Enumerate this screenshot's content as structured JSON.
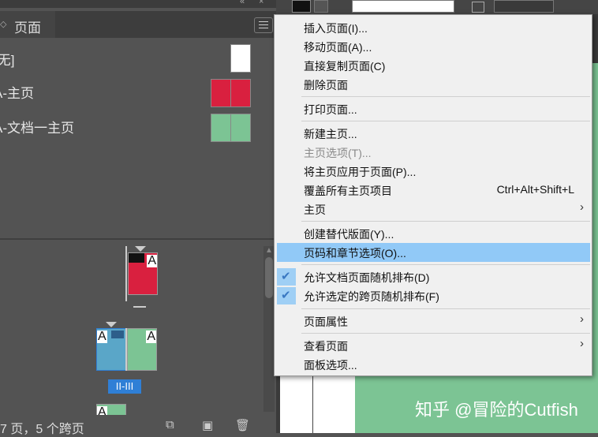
{
  "panel": {
    "tab_title": "页面",
    "masters": [
      {
        "label": "[无]"
      },
      {
        "label": "A-主页"
      },
      {
        "label": "A-文档一主页"
      }
    ],
    "page_letter": "A",
    "spread_label": "II-III",
    "footer_text": "7 页，5 个跨页"
  },
  "menu": {
    "items": [
      {
        "label": "插入页面(I)..."
      },
      {
        "label": "移动页面(A)..."
      },
      {
        "label": "直接复制页面(C)"
      },
      {
        "label": "删除页面"
      },
      {
        "label": "打印页面..."
      },
      {
        "label": "新建主页..."
      },
      {
        "label": "主页选项(T)...",
        "disabled": true
      },
      {
        "label": "将主页应用于页面(P)..."
      },
      {
        "label": "覆盖所有主页项目",
        "shortcut": "Ctrl+Alt+Shift+L"
      },
      {
        "label": "主页",
        "submenu": true
      },
      {
        "label": "创建替代版面(Y)..."
      },
      {
        "label": "页码和章节选项(O)...",
        "highlighted": true
      },
      {
        "label": "允许文档页面随机排布(D)",
        "checked": true
      },
      {
        "label": "允许选定的跨页随机排布(F)",
        "checked": true
      },
      {
        "label": "页面属性",
        "submenu": true
      },
      {
        "label": "查看页面",
        "submenu": true
      },
      {
        "label": "面板选项..."
      }
    ]
  },
  "document": {
    "watermark": "知乎 @冒险的Cutfish"
  },
  "colors": {
    "red_master": "#d9203f",
    "green_master": "#7cc494",
    "blue_selected": "#5aa6c8",
    "highlight": "#91c9f7"
  },
  "icons": [
    "collapse-arrows-icon",
    "panel-menu-icon",
    "checkmark-icon",
    "submenu-arrow-icon",
    "new-page-icon",
    "duplicate-icon",
    "trash-icon"
  ]
}
